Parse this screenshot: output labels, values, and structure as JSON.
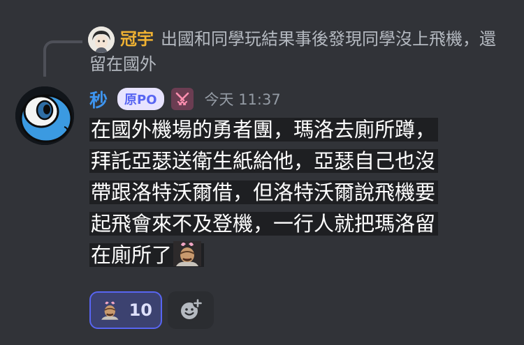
{
  "reply": {
    "author": "冠宇",
    "text": "出國和同學玩結果事後發現同學沒上飛機，還留在國外"
  },
  "message": {
    "author": "秒",
    "op_badge": "原PO",
    "timestamp": "今天 11:37",
    "lines": [
      "在國外機場的勇者團，瑪洛去廁所蹲，",
      "拜託亞瑟送衛生紙給他，亞瑟自己也沒",
      "帶跟洛特沃爾借，但洛特沃爾說飛機要",
      "起飛會來不及登機，一行人就把瑪洛留",
      "在廁所了"
    ],
    "inline_emoji": "laughing-man-emoji"
  },
  "reactions": [
    {
      "emoji": "laughing-man-emoji",
      "count": "10",
      "active": true
    }
  ],
  "colors": {
    "background": "#313338",
    "author": "#3e95f0",
    "reply_author": "#f0b232",
    "op_badge_text": "#5865f2",
    "reaction_active": "#5865f2"
  }
}
